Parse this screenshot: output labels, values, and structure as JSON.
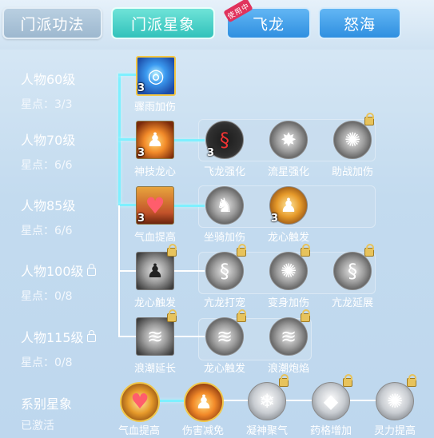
{
  "tabs": [
    {
      "label": "门派功法",
      "style": "gray"
    },
    {
      "label": "门派星象",
      "style": "active"
    },
    {
      "label": "飞龙",
      "style": "blue",
      "badge": "使用中"
    },
    {
      "label": "怒海",
      "style": "blue"
    }
  ],
  "levels": [
    {
      "title": "人物60级",
      "stars": "星点：3/3",
      "locked": false
    },
    {
      "title": "人物70级",
      "stars": "星点：6/6",
      "locked": false
    },
    {
      "title": "人物85级",
      "stars": "星点：6/6",
      "locked": false
    },
    {
      "title": "人物100级",
      "stars": "星点：0/8",
      "locked": true
    },
    {
      "title": "人物115级",
      "stars": "星点：0/8",
      "locked": true
    }
  ],
  "skills": {
    "row1": [
      {
        "label": "骤雨加伤",
        "count": "3",
        "icon": "storm-icon"
      }
    ],
    "row2": [
      {
        "label": "神技龙心",
        "count": "3",
        "icon": "warrior-icon"
      },
      {
        "label": "飞龙强化",
        "count": "3",
        "icon": "dragon-icon"
      },
      {
        "label": "流星强化",
        "count": "",
        "icon": "meteor-icon"
      },
      {
        "label": "助战加伤",
        "count": "",
        "icon": "spirit-icon"
      }
    ],
    "row3": [
      {
        "label": "气血提高",
        "count": "3",
        "icon": "heart-icon"
      },
      {
        "label": "坐骑加伤",
        "count": "",
        "icon": "mount-icon"
      },
      {
        "label": "龙心触发",
        "count": "3",
        "icon": "flame-figure-icon"
      }
    ],
    "row4": [
      {
        "label": "龙心触发",
        "count": "",
        "icon": "warrior-icon"
      },
      {
        "label": "亢龙打宠",
        "count": "",
        "icon": "dragon-icon"
      },
      {
        "label": "变身加伤",
        "count": "",
        "icon": "spirit-icon"
      },
      {
        "label": "亢龙延展",
        "count": "",
        "icon": "dragon-icon"
      }
    ],
    "row5": [
      {
        "label": "浪潮延长",
        "count": "",
        "icon": "wave-icon"
      },
      {
        "label": "龙心触发",
        "count": "",
        "icon": "wave-icon"
      },
      {
        "label": "浪潮炮焰",
        "count": "",
        "icon": "wave-icon"
      }
    ]
  },
  "series": {
    "title": "系别星象",
    "status": "已激活",
    "items": [
      {
        "label": "气血提高",
        "icon": "heart-icon"
      },
      {
        "label": "伤害减免",
        "icon": "shield-figure-icon"
      },
      {
        "label": "凝神聚气",
        "icon": "snowflake-icon"
      },
      {
        "label": "药格增加",
        "icon": "crystal-icon"
      },
      {
        "label": "灵力提高",
        "icon": "sun-hand-icon"
      }
    ]
  },
  "colors": {
    "active_tab": "#31c2bb",
    "blue_tab": "#2f8fe0",
    "glow_line": "#7ef0ff",
    "badge": "#e0335d"
  }
}
